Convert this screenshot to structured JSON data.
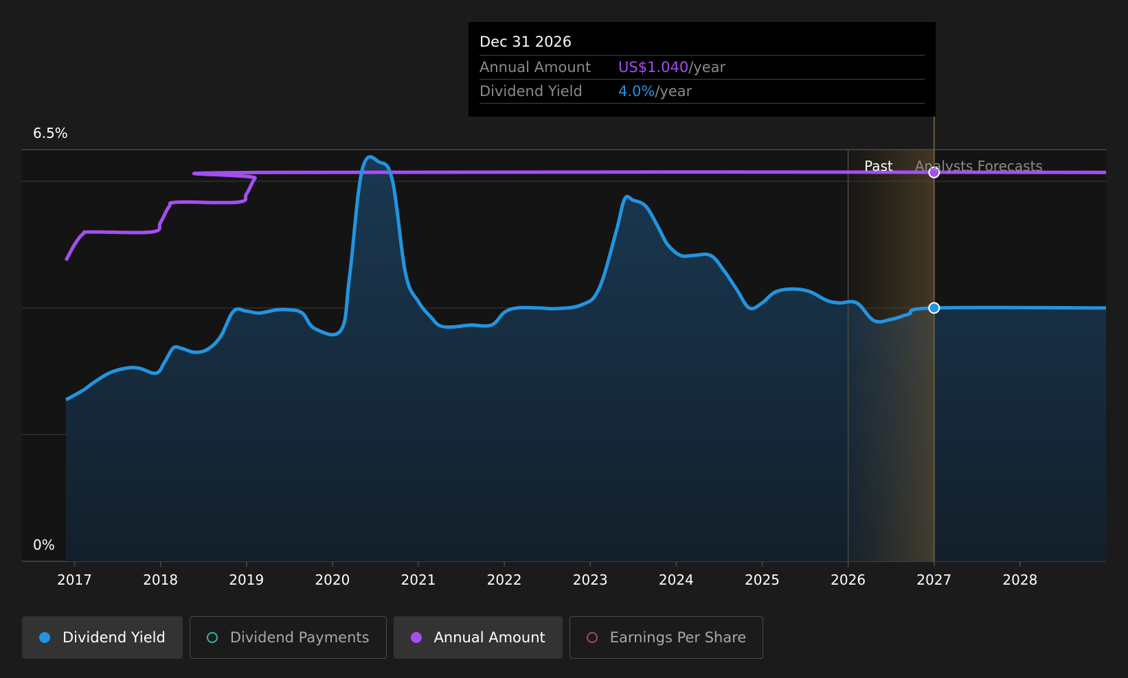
{
  "chart_data": {
    "type": "line",
    "y_axis": {
      "label_top": "6.5%",
      "label_bottom": "0%",
      "ylim": [
        0,
        6.5
      ]
    },
    "x_ticks": [
      "2017",
      "2018",
      "2019",
      "2020",
      "2021",
      "2022",
      "2023",
      "2024",
      "2025",
      "2026",
      "2027",
      "2028"
    ],
    "xlim": [
      2016.9,
      2029.0
    ],
    "regions": {
      "past_label": "Past",
      "forecast_label": "Analysts Forecasts",
      "past_start": 2026.0,
      "divider": 2027.0
    },
    "series": [
      {
        "name": "Annual Amount",
        "color": "#a54ff2",
        "points": [
          [
            2016.9,
            4.75
          ],
          [
            2017.0,
            5.0
          ],
          [
            2017.1,
            5.17
          ],
          [
            2017.2,
            5.2
          ],
          [
            2017.9,
            5.2
          ],
          [
            2018.0,
            5.35
          ],
          [
            2018.1,
            5.6
          ],
          [
            2018.2,
            5.67
          ],
          [
            2018.9,
            5.67
          ],
          [
            2019.0,
            5.8
          ],
          [
            2019.1,
            6.05
          ],
          [
            2019.2,
            6.14
          ],
          [
            2029.0,
            6.14
          ]
        ]
      },
      {
        "name": "Dividend Yield",
        "color": "#2394df",
        "points": [
          [
            2016.9,
            2.55
          ],
          [
            2017.1,
            2.7
          ],
          [
            2017.2,
            2.8
          ],
          [
            2017.4,
            2.97
          ],
          [
            2017.6,
            3.05
          ],
          [
            2017.75,
            3.05
          ],
          [
            2017.95,
            2.97
          ],
          [
            2018.05,
            3.15
          ],
          [
            2018.15,
            3.37
          ],
          [
            2018.25,
            3.36
          ],
          [
            2018.4,
            3.3
          ],
          [
            2018.55,
            3.35
          ],
          [
            2018.7,
            3.55
          ],
          [
            2018.85,
            3.95
          ],
          [
            2019.0,
            3.95
          ],
          [
            2019.15,
            3.92
          ],
          [
            2019.35,
            3.97
          ],
          [
            2019.5,
            3.97
          ],
          [
            2019.65,
            3.92
          ],
          [
            2019.8,
            3.67
          ],
          [
            2020.1,
            3.65
          ],
          [
            2020.2,
            4.5
          ],
          [
            2020.35,
            6.2
          ],
          [
            2020.55,
            6.3
          ],
          [
            2020.7,
            6.0
          ],
          [
            2020.85,
            4.55
          ],
          [
            2021.0,
            4.1
          ],
          [
            2021.15,
            3.85
          ],
          [
            2021.25,
            3.72
          ],
          [
            2021.4,
            3.7
          ],
          [
            2021.6,
            3.73
          ],
          [
            2021.85,
            3.73
          ],
          [
            2022.0,
            3.93
          ],
          [
            2022.15,
            4.0
          ],
          [
            2022.4,
            4.0
          ],
          [
            2022.6,
            3.99
          ],
          [
            2022.9,
            4.05
          ],
          [
            2023.1,
            4.3
          ],
          [
            2023.3,
            5.2
          ],
          [
            2023.4,
            5.72
          ],
          [
            2023.5,
            5.7
          ],
          [
            2023.65,
            5.6
          ],
          [
            2023.8,
            5.25
          ],
          [
            2023.9,
            5.0
          ],
          [
            2024.05,
            4.83
          ],
          [
            2024.2,
            4.83
          ],
          [
            2024.4,
            4.83
          ],
          [
            2024.55,
            4.6
          ],
          [
            2024.7,
            4.3
          ],
          [
            2024.85,
            4.0
          ],
          [
            2025.0,
            4.08
          ],
          [
            2025.15,
            4.25
          ],
          [
            2025.35,
            4.3
          ],
          [
            2025.55,
            4.26
          ],
          [
            2025.75,
            4.12
          ],
          [
            2025.9,
            4.08
          ],
          [
            2026.1,
            4.08
          ],
          [
            2026.3,
            3.8
          ],
          [
            2026.5,
            3.82
          ],
          [
            2026.7,
            3.9
          ],
          [
            2027.0,
            4.0
          ],
          [
            2029.0,
            4.0
          ]
        ]
      }
    ],
    "highlight": {
      "x": 2027.0,
      "annual_amount": 6.14,
      "dividend_yield": 4.0
    }
  },
  "tooltip": {
    "date": "Dec 31 2026",
    "rows": [
      {
        "key": "Annual Amount",
        "value": "US$1.040",
        "unit": "/year",
        "color": "#a54ff2"
      },
      {
        "key": "Dividend Yield",
        "value": "4.0%",
        "unit": "/year",
        "color": "#2394df"
      }
    ]
  },
  "legend": [
    {
      "label": "Dividend Yield",
      "color": "#2394df",
      "active": true
    },
    {
      "label": "Dividend Payments",
      "color": "#35b5a5",
      "active": false
    },
    {
      "label": "Annual Amount",
      "color": "#a54ff2",
      "active": true
    },
    {
      "label": "Earnings Per Share",
      "color": "#a8457b",
      "active": false
    }
  ]
}
